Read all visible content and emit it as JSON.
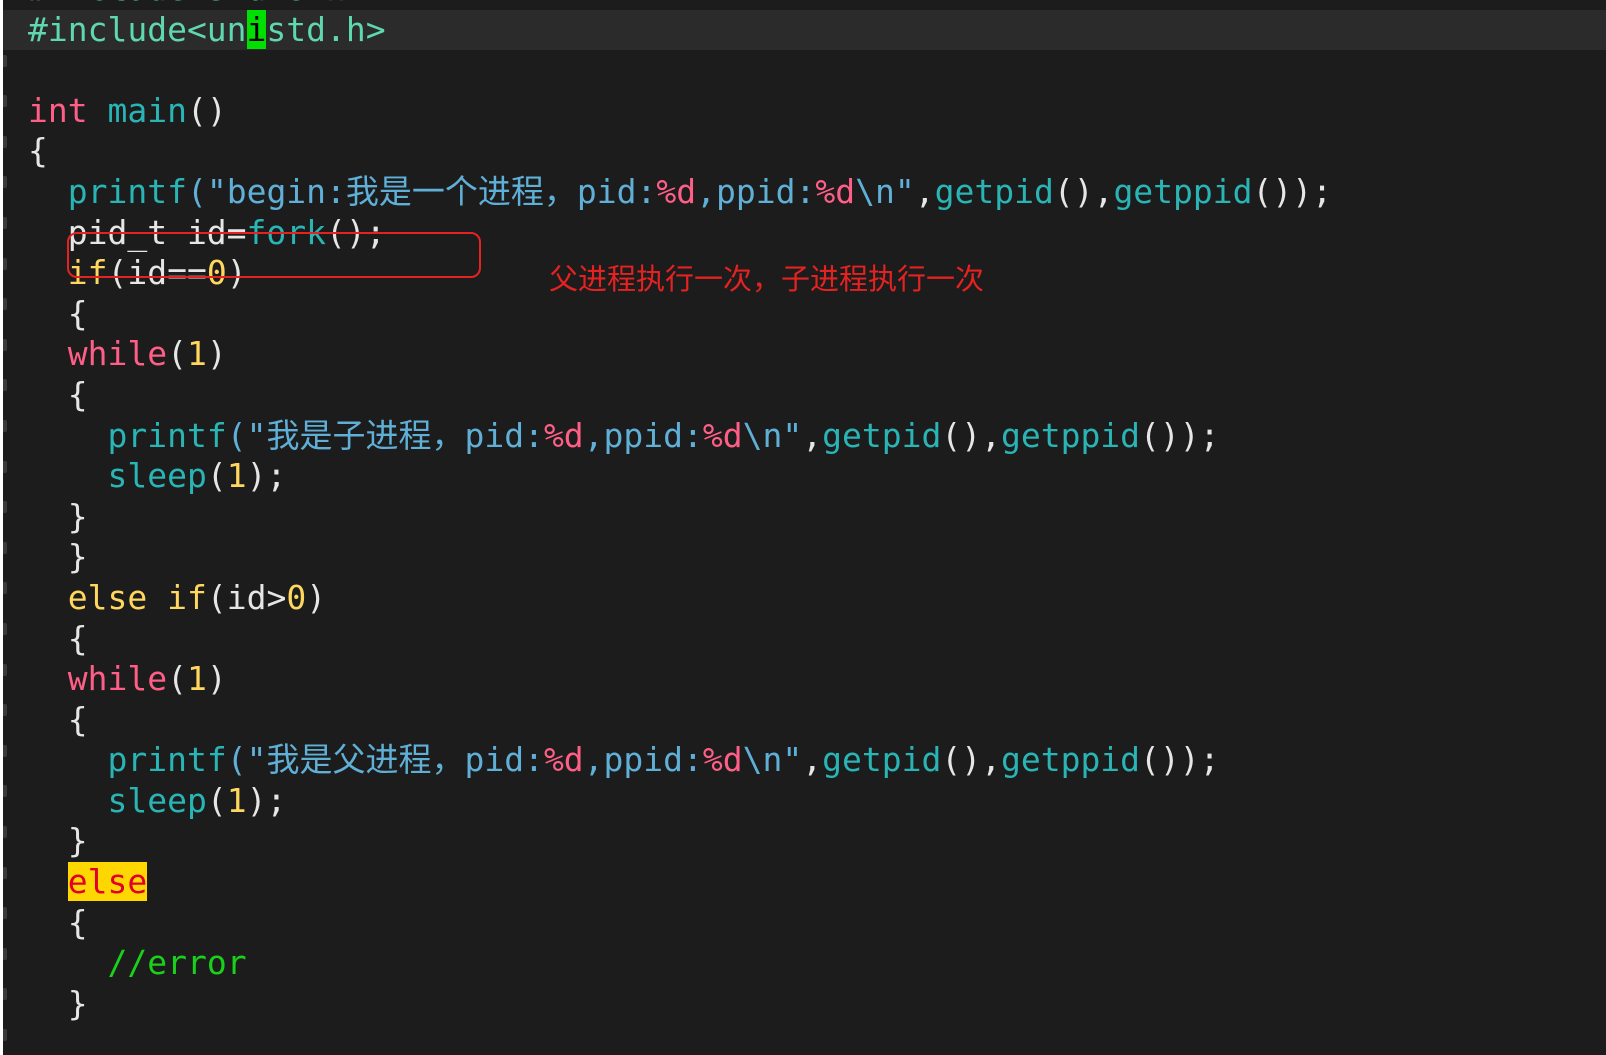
{
  "editor": {
    "lines": [
      [
        {
          "t": "#include<stdio.h>",
          "c": "t-pre"
        }
      ],
      [
        {
          "t": "#include<un",
          "c": "t-pre"
        },
        {
          "t": "i",
          "c": "cursor-block"
        },
        {
          "t": "std.h>",
          "c": "t-pre"
        }
      ],
      [],
      [
        {
          "t": "int",
          "c": "t-type"
        },
        {
          "t": " ",
          "c": "t-plain"
        },
        {
          "t": "main",
          "c": "t-func"
        },
        {
          "t": "()",
          "c": "t-punct"
        }
      ],
      [
        {
          "t": "{",
          "c": "t-punct"
        }
      ],
      [
        {
          "t": "  ",
          "c": "t-plain"
        },
        {
          "t": "printf",
          "c": "t-func"
        },
        {
          "t": "(\"begin:",
          "c": "t-str"
        },
        {
          "t": "我是一个进程，",
          "c": "t-str t-cjk"
        },
        {
          "t": "pid:",
          "c": "t-str"
        },
        {
          "t": "%d",
          "c": "t-fmt"
        },
        {
          "t": ",ppid:",
          "c": "t-str"
        },
        {
          "t": "%d",
          "c": "t-fmt"
        },
        {
          "t": "\\n\"",
          "c": "t-str"
        },
        {
          "t": ",",
          "c": "t-punct"
        },
        {
          "t": "getpid",
          "c": "t-func"
        },
        {
          "t": "(),",
          "c": "t-punct"
        },
        {
          "t": "getppid",
          "c": "t-func"
        },
        {
          "t": "());",
          "c": "t-punct"
        }
      ],
      [
        {
          "t": "  pid_t id=",
          "c": "t-plain"
        },
        {
          "t": "fork",
          "c": "t-func"
        },
        {
          "t": "();",
          "c": "t-punct"
        }
      ],
      [
        {
          "t": "  ",
          "c": "t-plain"
        },
        {
          "t": "if",
          "c": "t-kw"
        },
        {
          "t": "(id==",
          "c": "t-plain"
        },
        {
          "t": "0",
          "c": "t-num"
        },
        {
          "t": ")",
          "c": "t-punct"
        }
      ],
      [
        {
          "t": "  {",
          "c": "t-punct"
        }
      ],
      [
        {
          "t": "  ",
          "c": "t-plain"
        },
        {
          "t": "while",
          "c": "t-loop"
        },
        {
          "t": "(",
          "c": "t-punct"
        },
        {
          "t": "1",
          "c": "t-num"
        },
        {
          "t": ")",
          "c": "t-punct"
        }
      ],
      [
        {
          "t": "  {",
          "c": "t-punct"
        }
      ],
      [
        {
          "t": "    ",
          "c": "t-plain"
        },
        {
          "t": "printf",
          "c": "t-func"
        },
        {
          "t": "(\"",
          "c": "t-str"
        },
        {
          "t": "我是子进程，",
          "c": "t-str t-cjk"
        },
        {
          "t": "pid:",
          "c": "t-str"
        },
        {
          "t": "%d",
          "c": "t-fmt"
        },
        {
          "t": ",ppid:",
          "c": "t-str"
        },
        {
          "t": "%d",
          "c": "t-fmt"
        },
        {
          "t": "\\n\"",
          "c": "t-str"
        },
        {
          "t": ",",
          "c": "t-punct"
        },
        {
          "t": "getpid",
          "c": "t-func"
        },
        {
          "t": "(),",
          "c": "t-punct"
        },
        {
          "t": "getppid",
          "c": "t-func"
        },
        {
          "t": "());",
          "c": "t-punct"
        }
      ],
      [
        {
          "t": "    ",
          "c": "t-plain"
        },
        {
          "t": "sleep",
          "c": "t-func"
        },
        {
          "t": "(",
          "c": "t-punct"
        },
        {
          "t": "1",
          "c": "t-num"
        },
        {
          "t": ");",
          "c": "t-punct"
        }
      ],
      [
        {
          "t": "  }",
          "c": "t-punct"
        }
      ],
      [
        {
          "t": "  }",
          "c": "t-punct"
        }
      ],
      [
        {
          "t": "  ",
          "c": "t-plain"
        },
        {
          "t": "else",
          "c": "t-kw"
        },
        {
          "t": " ",
          "c": "t-plain"
        },
        {
          "t": "if",
          "c": "t-kw"
        },
        {
          "t": "(id>",
          "c": "t-plain"
        },
        {
          "t": "0",
          "c": "t-num"
        },
        {
          "t": ")",
          "c": "t-punct"
        }
      ],
      [
        {
          "t": "  {",
          "c": "t-punct"
        }
      ],
      [
        {
          "t": "  ",
          "c": "t-plain"
        },
        {
          "t": "while",
          "c": "t-loop"
        },
        {
          "t": "(",
          "c": "t-punct"
        },
        {
          "t": "1",
          "c": "t-num"
        },
        {
          "t": ")",
          "c": "t-punct"
        }
      ],
      [
        {
          "t": "  {",
          "c": "t-punct"
        }
      ],
      [
        {
          "t": "    ",
          "c": "t-plain"
        },
        {
          "t": "printf",
          "c": "t-func"
        },
        {
          "t": "(\"",
          "c": "t-str"
        },
        {
          "t": "我是父进程，",
          "c": "t-str t-cjk"
        },
        {
          "t": "pid:",
          "c": "t-str"
        },
        {
          "t": "%d",
          "c": "t-fmt"
        },
        {
          "t": ",ppid:",
          "c": "t-str"
        },
        {
          "t": "%d",
          "c": "t-fmt"
        },
        {
          "t": "\\n\"",
          "c": "t-str"
        },
        {
          "t": ",",
          "c": "t-punct"
        },
        {
          "t": "getpid",
          "c": "t-func"
        },
        {
          "t": "(),",
          "c": "t-punct"
        },
        {
          "t": "getppid",
          "c": "t-func"
        },
        {
          "t": "());",
          "c": "t-punct"
        }
      ],
      [
        {
          "t": "    ",
          "c": "t-plain"
        },
        {
          "t": "sleep",
          "c": "t-func"
        },
        {
          "t": "(",
          "c": "t-punct"
        },
        {
          "t": "1",
          "c": "t-num"
        },
        {
          "t": ");",
          "c": "t-punct"
        }
      ],
      [
        {
          "t": "  }",
          "c": "t-punct"
        }
      ],
      [
        {
          "t": "  ",
          "c": "t-plain"
        },
        {
          "t": "else",
          "c": "search-hl"
        }
      ],
      [
        {
          "t": "  {",
          "c": "t-punct"
        }
      ],
      [
        {
          "t": "    ",
          "c": "t-plain"
        },
        {
          "t": "//error",
          "c": "t-comment"
        }
      ],
      [
        {
          "t": "  }",
          "c": "t-punct"
        }
      ]
    ],
    "cursor_line": 1
  },
  "annotation": {
    "text": "父进程执行一次，子进程执行一次",
    "color": "#e52222"
  },
  "colors": {
    "background": "#1c1c1c",
    "cursor_line_bg": "#2b2b2b",
    "cursor": "#00e000",
    "search_highlight": "#ffd700"
  }
}
